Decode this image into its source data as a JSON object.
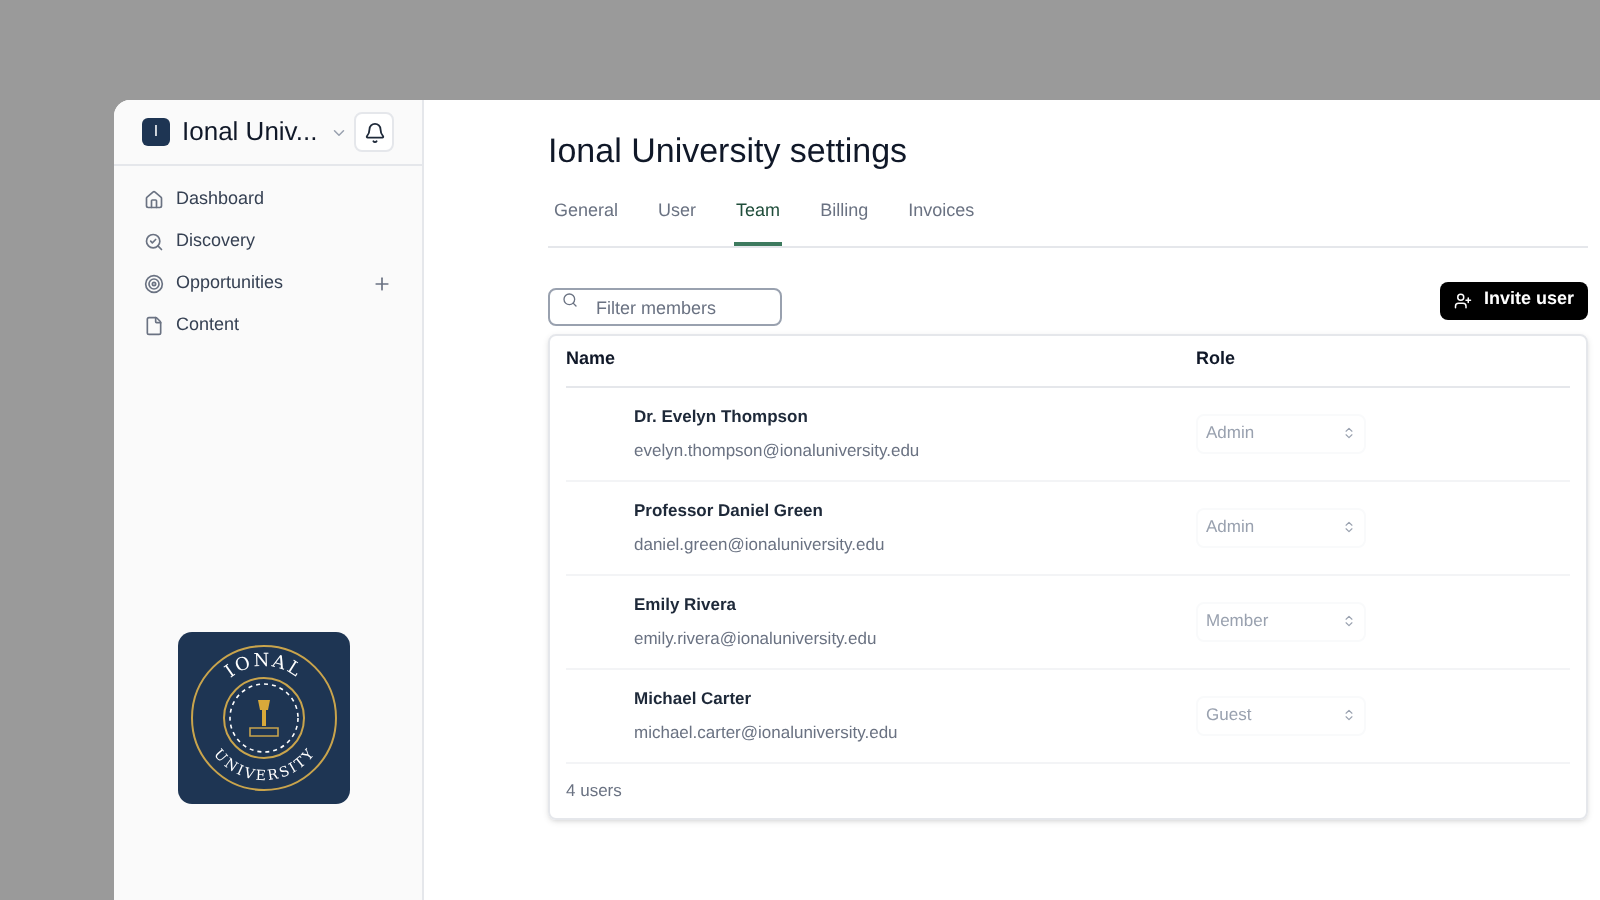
{
  "sidebar": {
    "workspace": {
      "initial": "I",
      "name": "Ional Univ..."
    },
    "items": [
      {
        "kind": "home",
        "label": "Dashboard"
      },
      {
        "kind": "search",
        "label": "Discovery"
      },
      {
        "kind": "target",
        "label": "Opportunities",
        "addable": true
      },
      {
        "kind": "file",
        "label": "Content"
      }
    ],
    "logo": {
      "top_text": "IONAL",
      "bottom_text": "UNIVERSITY"
    }
  },
  "title": "Ional University settings",
  "tabs": [
    {
      "label": "General",
      "selected": false
    },
    {
      "label": "User",
      "selected": false
    },
    {
      "label": "Team",
      "selected": true
    },
    {
      "label": "Billing",
      "selected": false
    },
    {
      "label": "Invoices",
      "selected": false
    }
  ],
  "filter": {
    "placeholder": "Filter members"
  },
  "invite_button": "Invite user",
  "table": {
    "columns": [
      "Name",
      "Role"
    ],
    "rows": [
      {
        "name": "Dr. Evelyn Thompson",
        "email": "evelyn.thompson@ionaluniversity.edu",
        "role": "Admin",
        "disabled": true
      },
      {
        "name": "Professor Daniel Green",
        "email": "daniel.green@ionaluniversity.edu",
        "role": "Admin",
        "disabled": true
      },
      {
        "name": "Emily Rivera",
        "email": "emily.rivera@ionaluniversity.edu",
        "role": "Member",
        "disabled": true
      },
      {
        "name": "Michael Carter",
        "email": "michael.carter@ionaluniversity.edu",
        "role": "Guest",
        "disabled": true
      }
    ],
    "footer": "4 users"
  }
}
